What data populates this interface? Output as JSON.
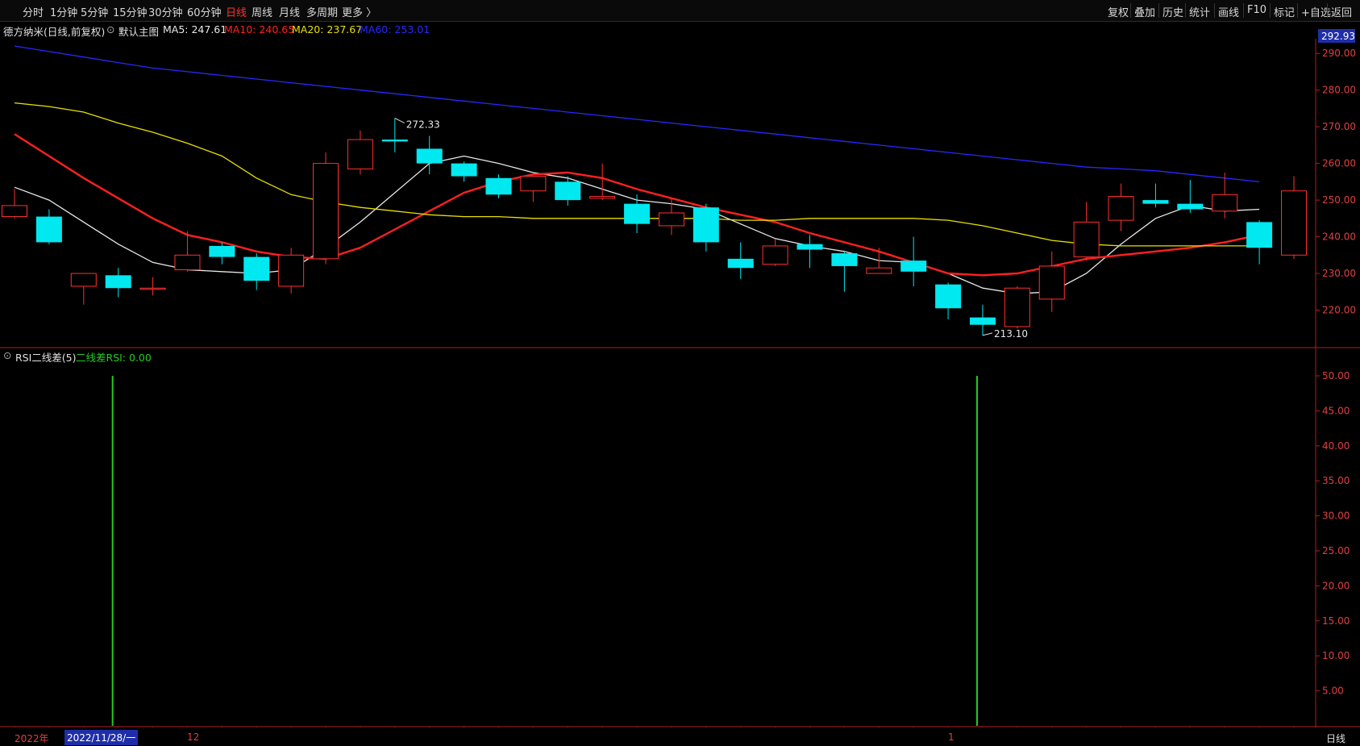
{
  "toolbar": {
    "timeframes": [
      "分时",
      "1分钟",
      "5分钟",
      "15分钟",
      "30分钟",
      "60分钟",
      "日线",
      "周线",
      "月线",
      "多周期",
      "更多 〉"
    ],
    "active_timeframe": "日线",
    "right_buttons": [
      "复权",
      "叠加",
      "历史",
      "统计",
      "画线",
      "F10",
      "标记",
      "+自选",
      "返回"
    ]
  },
  "main_legend": {
    "title": "德方纳米(日线,前复权)",
    "indicator": "默认主图",
    "ma5": "MA5: 247.61",
    "ma10": "MA10: 240.65",
    "ma20": "MA20: 237.67",
    "ma60": "MA60: 253.01",
    "colors": {
      "ma5": "#e8e8e8",
      "ma10": "#ff2020",
      "ma20": "#e8e000",
      "ma60": "#2828ff"
    }
  },
  "price_tag": "292.93",
  "rsi_legend": {
    "title": "RSI二线差(5)",
    "value": "二线差RSI: 0.00"
  },
  "bottom": {
    "year": "2022年",
    "cursor_date": "2022/11/28/一",
    "month_12": "12",
    "month_1": "1",
    "period": "日线"
  },
  "chart_data": [
    {
      "type": "candlestick",
      "title": "德方纳米(日线,前复权)",
      "yaxis_ticks": [
        220,
        230,
        240,
        250,
        260,
        270,
        280,
        290
      ],
      "ylim": [
        210,
        294
      ],
      "annotations": [
        {
          "label": "272.33",
          "candle": 11
        },
        {
          "label": "213.10",
          "candle": 28
        }
      ],
      "candles": [
        {
          "o": 245.5,
          "h": 253.0,
          "l": 245.0,
          "c": 248.5
        },
        {
          "o": 245.5,
          "h": 247.5,
          "l": 238.0,
          "c": 238.5
        },
        {
          "o": 226.5,
          "h": 230.0,
          "l": 221.5,
          "c": 230.0
        },
        {
          "o": 229.5,
          "h": 231.5,
          "l": 223.5,
          "c": 226.0
        },
        {
          "o": 226.0,
          "h": 229.0,
          "l": 224.0,
          "c": 226.0
        },
        {
          "o": 231.0,
          "h": 241.5,
          "l": 230.5,
          "c": 235.0
        },
        {
          "o": 237.5,
          "h": 238.5,
          "l": 232.5,
          "c": 234.5
        },
        {
          "o": 234.5,
          "h": 235.5,
          "l": 225.5,
          "c": 228.0
        },
        {
          "o": 226.5,
          "h": 237.0,
          "l": 224.5,
          "c": 235.0
        },
        {
          "o": 234.0,
          "h": 263.0,
          "l": 232.5,
          "c": 260.0
        },
        {
          "o": 258.5,
          "h": 269.0,
          "l": 257.0,
          "c": 266.5
        },
        {
          "o": 266.5,
          "h": 272.33,
          "l": 263.0,
          "c": 266.0
        },
        {
          "o": 264.0,
          "h": 267.5,
          "l": 257.0,
          "c": 260.0
        },
        {
          "o": 260.0,
          "h": 260.5,
          "l": 255.0,
          "c": 256.5
        },
        {
          "o": 256.0,
          "h": 257.0,
          "l": 250.5,
          "c": 251.5
        },
        {
          "o": 252.5,
          "h": 256.5,
          "l": 249.5,
          "c": 256.5
        },
        {
          "o": 255.0,
          "h": 256.5,
          "l": 248.5,
          "c": 250.0
        },
        {
          "o": 250.5,
          "h": 260.0,
          "l": 250.0,
          "c": 251.0
        },
        {
          "o": 249.0,
          "h": 251.5,
          "l": 241.0,
          "c": 243.5
        },
        {
          "o": 243.0,
          "h": 250.5,
          "l": 240.5,
          "c": 246.5
        },
        {
          "o": 248.0,
          "h": 249.0,
          "l": 236.0,
          "c": 238.5
        },
        {
          "o": 234.0,
          "h": 238.5,
          "l": 228.5,
          "c": 231.5
        },
        {
          "o": 232.5,
          "h": 239.5,
          "l": 232.0,
          "c": 237.5
        },
        {
          "o": 238.0,
          "h": 240.5,
          "l": 231.5,
          "c": 236.5
        },
        {
          "o": 235.5,
          "h": 236.0,
          "l": 225.0,
          "c": 232.0
        },
        {
          "o": 230.0,
          "h": 237.0,
          "l": 230.0,
          "c": 231.5
        },
        {
          "o": 233.5,
          "h": 240.0,
          "l": 226.5,
          "c": 230.5
        },
        {
          "o": 227.0,
          "h": 227.5,
          "l": 217.5,
          "c": 220.5
        },
        {
          "o": 218.0,
          "h": 221.5,
          "l": 213.1,
          "c": 216.0
        },
        {
          "o": 215.5,
          "h": 226.5,
          "l": 215.0,
          "c": 226.0
        },
        {
          "o": 223.0,
          "h": 236.0,
          "l": 219.5,
          "c": 232.0
        },
        {
          "o": 234.5,
          "h": 249.5,
          "l": 233.5,
          "c": 244.0
        },
        {
          "o": 244.5,
          "h": 254.5,
          "l": 241.5,
          "c": 251.0
        },
        {
          "o": 250.0,
          "h": 254.5,
          "l": 248.0,
          "c": 249.0
        },
        {
          "o": 249.0,
          "h": 255.5,
          "l": 246.5,
          "c": 247.5
        },
        {
          "o": 247.0,
          "h": 257.5,
          "l": 245.0,
          "c": 251.5
        },
        {
          "o": 244.0,
          "h": 244.5,
          "l": 232.5,
          "c": 237.0
        },
        {
          "o": 235.0,
          "h": 256.5,
          "l": 234.0,
          "c": 252.5
        }
      ],
      "series": [
        {
          "name": "MA5",
          "color": "#e8e8e8",
          "values": [
            253.5,
            250,
            244,
            238,
            233,
            231,
            230.5,
            230,
            231,
            237,
            244,
            252,
            260,
            262,
            260,
            257.5,
            256,
            253,
            250,
            249,
            247.5,
            243.5,
            239.5,
            237.5,
            236,
            233.5,
            233,
            230,
            226,
            224.5,
            225,
            230,
            238,
            245,
            248.5,
            247,
            247.5
          ]
        },
        {
          "name": "MA10",
          "color": "#ff2020",
          "values": [
            268,
            262,
            256,
            250.5,
            245,
            240.5,
            238.5,
            236,
            234.5,
            234,
            237,
            242,
            247,
            252,
            255,
            257,
            257.5,
            256,
            253,
            250.5,
            248,
            246,
            244,
            241,
            238.5,
            236,
            233,
            230,
            229.5,
            230,
            232,
            234,
            235,
            236,
            237,
            238.5,
            240.5
          ]
        },
        {
          "name": "MA20",
          "color": "#e8e000",
          "values": [
            276.5,
            275.5,
            274,
            271,
            268.5,
            265.5,
            262,
            256,
            251.5,
            249.5,
            248,
            247,
            246,
            245.5,
            245.5,
            245,
            245,
            245,
            245,
            245,
            245,
            244.5,
            244.5,
            245,
            245,
            245,
            245,
            244.5,
            243,
            241,
            239,
            238,
            237.5,
            237.5,
            237.5,
            237.5,
            237.5
          ]
        },
        {
          "name": "MA60",
          "color": "#2828ff",
          "values": [
            292,
            290.5,
            289,
            287.5,
            286,
            285,
            284,
            283,
            282,
            281,
            280,
            279,
            278,
            277,
            276,
            275,
            274,
            273,
            272,
            271,
            270,
            269,
            268,
            267,
            266,
            265,
            264,
            263,
            262,
            261,
            260,
            259,
            258.5,
            258,
            257,
            256,
            255
          ]
        }
      ]
    },
    {
      "type": "bar",
      "title": "RSI二线差(5)",
      "yaxis_ticks": [
        5,
        10,
        15,
        20,
        25,
        30,
        35,
        40,
        45,
        50
      ],
      "ylim": [
        0,
        53
      ],
      "series": [
        {
          "name": "二线差RSI",
          "color": "#22cc22",
          "bars": [
            {
              "candle": 3,
              "value": 50
            },
            {
              "candle": 28,
              "value": 50
            }
          ]
        }
      ]
    }
  ]
}
